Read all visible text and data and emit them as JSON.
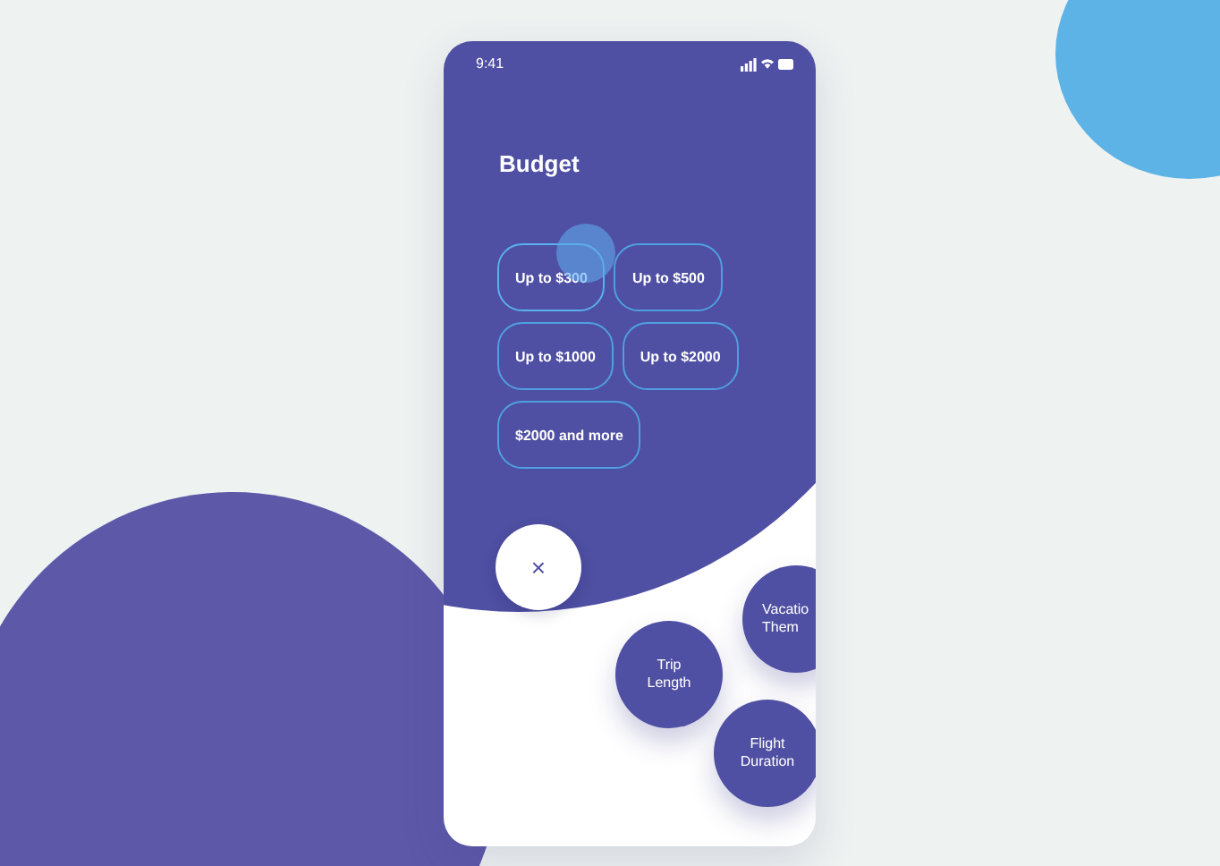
{
  "status_bar": {
    "time": "9:41"
  },
  "title": "Budget",
  "options": [
    {
      "label": "Up to $300",
      "selected": true
    },
    {
      "label": "Up to $500",
      "selected": false
    },
    {
      "label": "Up to $1000",
      "selected": false
    },
    {
      "label": "Up to $2000",
      "selected": false
    },
    {
      "label": "$2000 and more",
      "selected": false
    }
  ],
  "close_button": {
    "label": "×"
  },
  "categories": [
    {
      "lines": [
        "Vacatio",
        "Them"
      ],
      "kind": "clipped"
    },
    {
      "lines": [
        "Trip",
        "Length"
      ],
      "kind": "full"
    },
    {
      "lines": [
        "Flight",
        "Duration"
      ],
      "kind": "full"
    }
  ]
}
